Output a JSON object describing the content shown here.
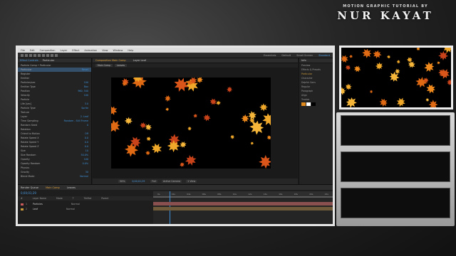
{
  "header": {
    "subtitle": "MOTION GRAPHIC TUTORIAL BY",
    "name": "NUR KAYAT"
  },
  "app": {
    "menu": [
      "File",
      "Edit",
      "Composition",
      "Layer",
      "Effect",
      "Animation",
      "View",
      "Window",
      "Help"
    ],
    "workspaces": [
      {
        "label": "Essentials",
        "active": false
      },
      {
        "label": "Default",
        "active": false
      },
      {
        "label": "Small Screen",
        "active": false
      },
      {
        "label": "Standard",
        "active": true
      }
    ]
  },
  "effect_controls": {
    "tabs": [
      {
        "label": "Effect Controls",
        "active": true
      },
      {
        "label": "Particular",
        "active": false
      }
    ],
    "rows": [
      {
        "label": "Particle Comp • Particular",
        "value": ""
      },
      {
        "label": "Particular",
        "value": "Reset"
      },
      {
        "label": "Register",
        "value": ""
      },
      {
        "label": "Emitter",
        "value": ""
      },
      {
        "label": "Particles/sec",
        "value": "100"
      },
      {
        "label": "Emitter Type",
        "value": "Box"
      },
      {
        "label": "Position",
        "value": "960, 540"
      },
      {
        "label": "Velocity",
        "value": "100"
      },
      {
        "label": "Particle",
        "value": ""
      },
      {
        "label": "Life [sec]",
        "value": "3.0"
      },
      {
        "label": "Particle Type",
        "value": "Sprite"
      },
      {
        "label": "Texture",
        "value": ""
      },
      {
        "label": "Layer",
        "value": "2. Leaf"
      },
      {
        "label": "Time Sampling",
        "value": "Random - Still Frame"
      },
      {
        "label": "Random Seed",
        "value": "0"
      },
      {
        "label": "Rotation",
        "value": ""
      },
      {
        "label": "Orient to Motion",
        "value": "Off"
      },
      {
        "label": "Rotate Speed X",
        "value": "0.0"
      },
      {
        "label": "Rotate Speed Y",
        "value": "0.0"
      },
      {
        "label": "Rotate Speed Z",
        "value": "0.0"
      },
      {
        "label": "Size",
        "value": "10"
      },
      {
        "label": "Size Random",
        "value": "50.0%"
      },
      {
        "label": "Opacity",
        "value": "100"
      },
      {
        "label": "Opacity Random",
        "value": "0.0%"
      },
      {
        "label": "Physics",
        "value": ""
      },
      {
        "label": "Gravity",
        "value": "30"
      },
      {
        "label": "Blend Mode",
        "value": "Normal"
      }
    ]
  },
  "composition": {
    "tabs": [
      {
        "label": "Composition Main Comp",
        "active": true
      },
      {
        "label": "Layer Leaf",
        "active": false
      }
    ],
    "sub_tabs": [
      "Main Comp",
      "Leaves"
    ],
    "viewer": {
      "zoom": "50%",
      "timecode": "0;00;01;29",
      "resolution": "Full",
      "camera": "Active Camera",
      "views": "1 View"
    }
  },
  "right_panel": {
    "title": "Info",
    "rows": [
      {
        "label": "Preview",
        "accent": false
      },
      {
        "label": "Effects & Presets",
        "accent": false
      },
      {
        "label": "Particular",
        "accent": true
      },
      {
        "label": "Character",
        "accent": false
      },
      {
        "label": "DejaVu Sans",
        "accent": false
      },
      {
        "label": "Regular",
        "accent": false
      },
      {
        "label": "Paragraph",
        "accent": false
      },
      {
        "label": "Align",
        "accent": false
      },
      {
        "label": "Tracker",
        "accent": false
      }
    ],
    "swatch_colors": [
      "#e08a1e",
      "#ffffff",
      "#000000"
    ]
  },
  "timeline": {
    "tabs": [
      {
        "label": "Render Queue",
        "active": false
      },
      {
        "label": "Main Comp",
        "active": true
      },
      {
        "label": "Leaves",
        "active": false
      }
    ],
    "timecode": "0;00;01;29",
    "columns": [
      "#",
      "Layer Name",
      "Mode",
      "T",
      "TrkMat",
      "Parent"
    ],
    "ruler_labels": [
      "0s",
      "02s",
      "04s",
      "06s",
      "08s",
      "10s",
      "12s",
      "14s",
      "16s",
      "18s",
      "20s",
      "22s"
    ],
    "playhead_fraction": 0.09,
    "layers": [
      {
        "num": "1",
        "name": "Particles",
        "mode": "Normal",
        "color": "#c85a5a",
        "bar_color": "#8a4f4f"
      },
      {
        "num": "2",
        "name": "Leaf",
        "mode": "Normal",
        "color": "#c99a3a",
        "bar_color": "#6f5a3a"
      }
    ]
  },
  "colors": {
    "accent_blue": "#4b9be0",
    "accent_orange": "#e3a33a",
    "leaf_colors": [
      "#e06a14",
      "#f08a1c",
      "#f0a82a",
      "#d9551a",
      "#f5b63a",
      "#c8421a"
    ]
  }
}
